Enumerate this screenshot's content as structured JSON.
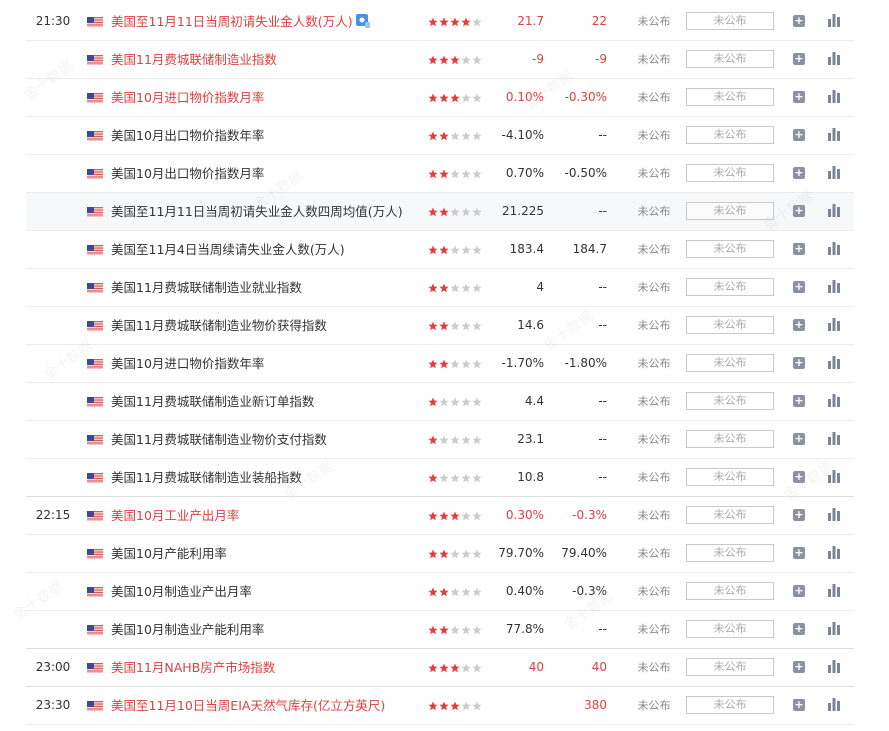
{
  "colors": {
    "accent": "#e13e3e",
    "star_on": "#e13e3e",
    "star_off": "#cccccc",
    "separator": "#ebebeb"
  },
  "watermark": "金十数据",
  "rows": [
    {
      "time": "21:30",
      "name": "美国至11月11日当周初请失业金人数(万人)",
      "stars": 4,
      "previous": "21.7",
      "forecast": "22",
      "actual": "未公布",
      "actual_value": "未公布",
      "highlight": true,
      "tag_icon": "tag-icon"
    },
    {
      "time": "",
      "name": "美国11月费城联储制造业指数",
      "stars": 3,
      "previous": "-9",
      "forecast": "-9",
      "actual": "未公布",
      "actual_value": "未公布",
      "highlight": true
    },
    {
      "time": "",
      "name": "美国10月进口物价指数月率",
      "stars": 3,
      "previous": "0.10%",
      "forecast": "-0.30%",
      "actual": "未公布",
      "actual_value": "未公布",
      "highlight": true
    },
    {
      "time": "",
      "name": "美国10月出口物价指数年率",
      "stars": 2,
      "previous": "-4.10%",
      "forecast": "--",
      "actual": "未公布",
      "actual_value": "未公布",
      "highlight": false
    },
    {
      "time": "",
      "name": "美国10月出口物价指数月率",
      "stars": 2,
      "previous": "0.70%",
      "forecast": "-0.50%",
      "actual": "未公布",
      "actual_value": "未公布",
      "highlight": false
    },
    {
      "time": "",
      "name": "美国至11月11日当周初请失业金人数四周均值(万人)",
      "stars": 2,
      "previous": "21.225",
      "forecast": "--",
      "actual": "未公布",
      "actual_value": "未公布",
      "highlight": false,
      "alt": true
    },
    {
      "time": "",
      "name": "美国至11月4日当周续请失业金人数(万人)",
      "stars": 2,
      "previous": "183.4",
      "forecast": "184.7",
      "actual": "未公布",
      "actual_value": "未公布",
      "highlight": false
    },
    {
      "time": "",
      "name": "美国11月费城联储制造业就业指数",
      "stars": 2,
      "previous": "4",
      "forecast": "--",
      "actual": "未公布",
      "actual_value": "未公布",
      "highlight": false
    },
    {
      "time": "",
      "name": "美国11月费城联储制造业物价获得指数",
      "stars": 2,
      "previous": "14.6",
      "forecast": "--",
      "actual": "未公布",
      "actual_value": "未公布",
      "highlight": false
    },
    {
      "time": "",
      "name": "美国10月进口物价指数年率",
      "stars": 2,
      "previous": "-1.70%",
      "forecast": "-1.80%",
      "actual": "未公布",
      "actual_value": "未公布",
      "highlight": false
    },
    {
      "time": "",
      "name": "美国11月费城联储制造业新订单指数",
      "stars": 1,
      "previous": "4.4",
      "forecast": "--",
      "actual": "未公布",
      "actual_value": "未公布",
      "highlight": false
    },
    {
      "time": "",
      "name": "美国11月费城联储制造业物价支付指数",
      "stars": 1,
      "previous": "23.1",
      "forecast": "--",
      "actual": "未公布",
      "actual_value": "未公布",
      "highlight": false
    },
    {
      "time": "",
      "name": "美国11月费城联储制造业装船指数",
      "stars": 1,
      "previous": "10.8",
      "forecast": "--",
      "actual": "未公布",
      "actual_value": "未公布",
      "highlight": false,
      "group_end": true
    },
    {
      "time": "22:15",
      "name": "美国10月工业产出月率",
      "stars": 3,
      "previous": "0.30%",
      "forecast": "-0.3%",
      "actual": "未公布",
      "actual_value": "未公布",
      "highlight": true
    },
    {
      "time": "",
      "name": "美国10月产能利用率",
      "stars": 2,
      "previous": "79.70%",
      "forecast": "79.40%",
      "actual": "未公布",
      "actual_value": "未公布",
      "highlight": false
    },
    {
      "time": "",
      "name": "美国10月制造业产出月率",
      "stars": 2,
      "previous": "0.40%",
      "forecast": "-0.3%",
      "actual": "未公布",
      "actual_value": "未公布",
      "highlight": false
    },
    {
      "time": "",
      "name": "美国10月制造业产能利用率",
      "stars": 2,
      "previous": "77.8%",
      "forecast": "--",
      "actual": "未公布",
      "actual_value": "未公布",
      "highlight": false,
      "group_end": true
    },
    {
      "time": "23:00",
      "name": "美国11月NAHB房产市场指数",
      "stars": 3,
      "previous": "40",
      "forecast": "40",
      "actual": "未公布",
      "actual_value": "未公布",
      "highlight": true,
      "group_end": true
    },
    {
      "time": "23:30",
      "name": "美国至11月10日当周EIA天然气库存(亿立方英尺)",
      "stars": 3,
      "previous": "",
      "forecast": "380",
      "actual": "未公布",
      "actual_value": "未公布",
      "highlight": true
    }
  ]
}
